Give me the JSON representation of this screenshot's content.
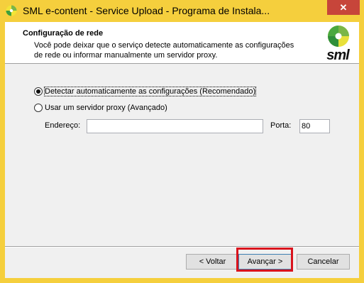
{
  "window": {
    "title": "SML e-content -  Service Upload - Programa de Instala...",
    "close_label": "✕"
  },
  "header": {
    "title": "Configuração de rede",
    "description": "Você pode deixar que o serviço detecte automaticamente as configurações de rede ou informar manualmente um servidor proxy.",
    "logo_text": "sml"
  },
  "options": {
    "auto_label": "Detectar automaticamente as configurações (Recomendado)",
    "proxy_label": "Usar um servidor proxy (Avançado)",
    "selected": "auto"
  },
  "proxy": {
    "address_label": "Endereço:",
    "address_value": "",
    "port_label": "Porta:",
    "port_value": "80"
  },
  "buttons": {
    "back": "< Voltar",
    "next": "Avançar >",
    "cancel": "Cancelar"
  },
  "colors": {
    "titlebar": "#f5cf3d",
    "close": "#c7453a",
    "highlight": "#d9131d"
  },
  "icons": {
    "app": "sml-logo-icon",
    "header_logo": "sml-logo"
  }
}
